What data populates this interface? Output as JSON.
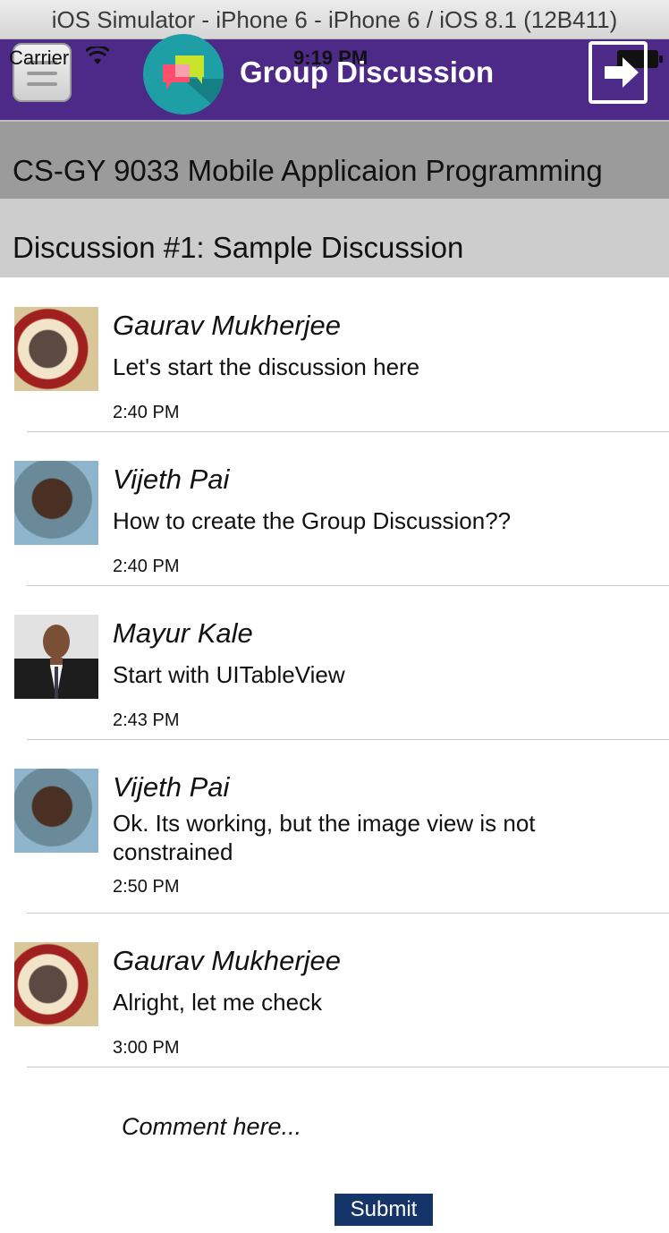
{
  "simulator": {
    "title": "iOS Simulator - iPhone 6 - iPhone 6 / iOS 8.1 (12B411)"
  },
  "status_bar": {
    "carrier": "Carrier",
    "time": "9:19 PM"
  },
  "navbar": {
    "title": "Group Discussion",
    "color": "#4d2a87"
  },
  "course": {
    "title": "CS-GY 9033 Mobile Applicaion Programming"
  },
  "discussion": {
    "title": "Discussion #1: Sample Discussion"
  },
  "messages": [
    {
      "author": "Gaurav Mukherjee",
      "text": "Let's start the discussion here",
      "time": "2:40 PM"
    },
    {
      "author": "Vijeth Pai",
      "text": "How to create the Group Discussion??",
      "time": "2:40 PM"
    },
    {
      "author": "Mayur Kale",
      "text": "Start with UITableView",
      "time": "2:43 PM"
    },
    {
      "author": "Vijeth Pai",
      "text": "Ok. Its working, but the image view is not constrained",
      "time": "2:50 PM"
    },
    {
      "author": "Gaurav Mukherjee",
      "text": "Alright, let me check",
      "time": "3:00 PM"
    }
  ],
  "comment": {
    "placeholder": "Comment here..."
  },
  "submit": {
    "label": "Submit",
    "color": "#15356a"
  }
}
